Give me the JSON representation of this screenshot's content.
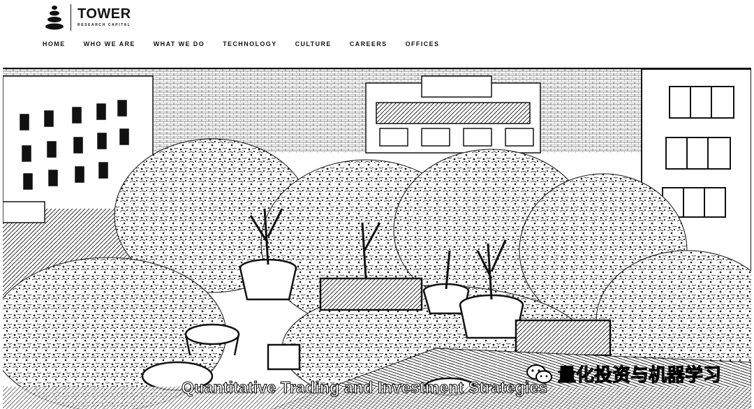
{
  "brand": {
    "name": "TOWER",
    "subtitle": "RESEARCH CAPITAL",
    "logo_icon": "stacked-stones-icon"
  },
  "nav": {
    "items": [
      {
        "label": "HOME"
      },
      {
        "label": "WHO WE ARE"
      },
      {
        "label": "WHAT WE DO"
      },
      {
        "label": "TECHNOLOGY"
      },
      {
        "label": "CULTURE"
      },
      {
        "label": "CAREERS"
      },
      {
        "label": "OFFICES"
      }
    ]
  },
  "hero": {
    "image_subject": "rooftop garden with potted trees between city buildings",
    "caption": "Quantitative Trading and Investment Strategies"
  },
  "watermark": {
    "icon": "wechat-icon",
    "text": "量化投资与机器学习"
  },
  "colors": {
    "ink": "#111111",
    "background": "#ffffff"
  }
}
